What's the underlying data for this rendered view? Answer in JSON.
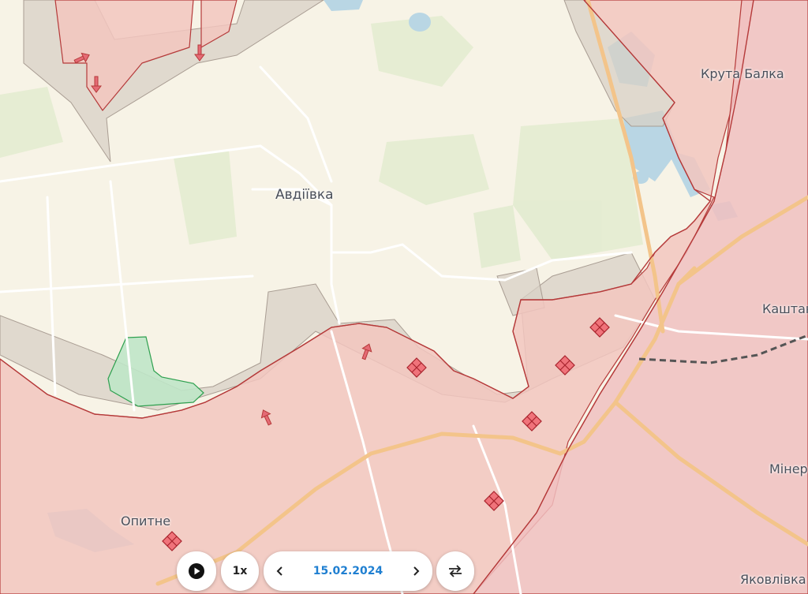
{
  "map": {
    "colors": {
      "background": "#f7f3e6",
      "occupied": "#f2c6be",
      "occupied_border": "#b53a3a",
      "contested": "#d8d0c6",
      "liberated": "#bfe6c8",
      "liberated_border": "#2ea04f",
      "water": "#b9d6e4",
      "roads": "#ffffff",
      "highway": "#f3c48a",
      "attack_arrow": "#e56b75",
      "fortification": "#f0737a"
    },
    "places": [
      {
        "id": "avdiivka",
        "name": "Авдіївка"
      },
      {
        "id": "kruta-balka",
        "name": "Крута Балка"
      },
      {
        "id": "kashtanove",
        "name": "Каштан"
      },
      {
        "id": "minerals",
        "name": "Мінер"
      },
      {
        "id": "opytne",
        "name": "Опитне"
      },
      {
        "id": "yakovlivka",
        "name": "Яковлівка"
      }
    ],
    "attack_arrows_count": 5,
    "fortification_markers_count": 6
  },
  "timeline": {
    "play_icon": "play-icon",
    "speed": "1x",
    "prev_icon": "chevron-left-icon",
    "date": "15.02.2024",
    "next_icon": "chevron-right-icon",
    "swap_icon": "swap-arrows-icon"
  }
}
